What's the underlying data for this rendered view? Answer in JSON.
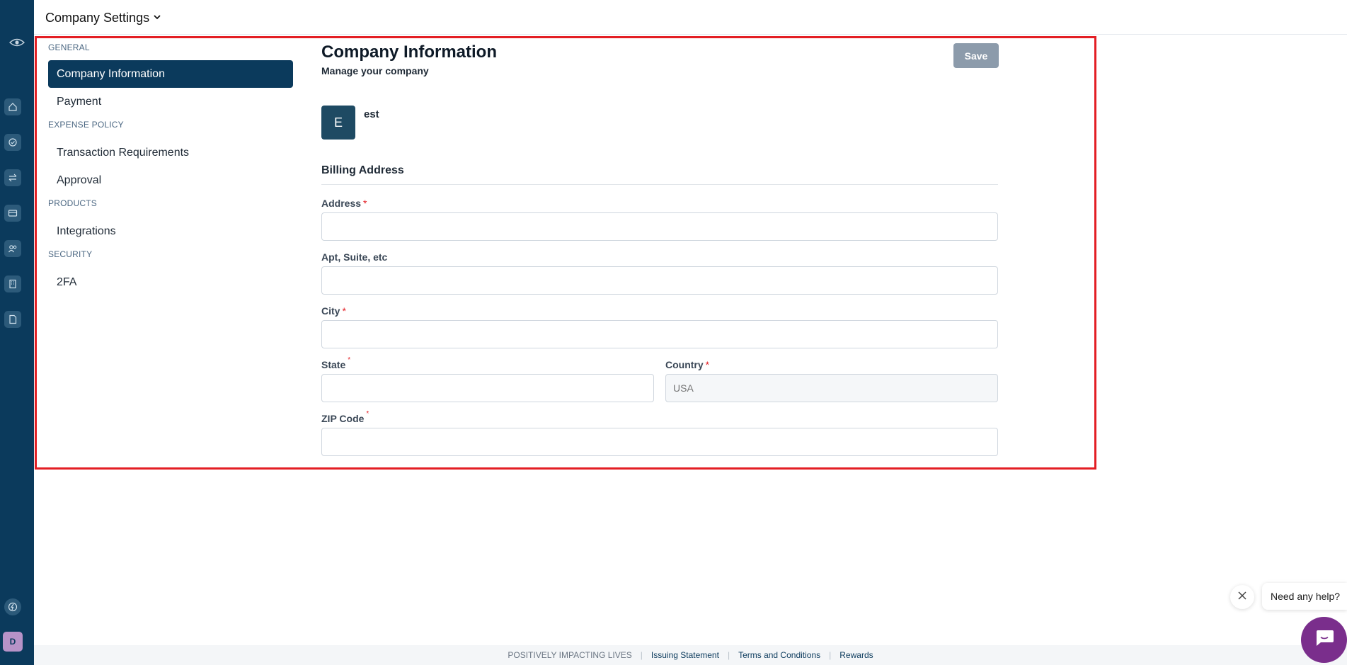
{
  "header": {
    "title": "Company Settings"
  },
  "rail": {
    "icons": [
      "eye-logo-icon",
      "home-icon",
      "check-circle-icon",
      "transfer-icon",
      "card-icon",
      "users-icon",
      "building-icon",
      "document-icon",
      "bolt-icon"
    ],
    "avatar_initial": "D"
  },
  "settings_nav": {
    "general": "GENERAL",
    "company_information": "Company Information",
    "payment": "Payment",
    "expense_policy": "EXPENSE POLICY",
    "transaction_requirements": "Transaction Requirements",
    "approval": "Approval",
    "products": "PRODUCTS",
    "integrations": "Integrations",
    "security": "SECURITY",
    "twofa": "2FA"
  },
  "main": {
    "title": "Company Information",
    "subtitle": "Manage your company",
    "save_label": "Save",
    "company_initial": "E",
    "company_name": "est",
    "billing_title": "Billing Address",
    "fields": {
      "address": {
        "label": "Address",
        "value": ""
      },
      "apt": {
        "label": "Apt, Suite, etc",
        "value": ""
      },
      "city": {
        "label": "City",
        "value": ""
      },
      "state": {
        "label": "State",
        "value": ""
      },
      "country": {
        "label": "Country",
        "value": "",
        "placeholder": "USA"
      },
      "zip": {
        "label": "ZIP Code",
        "value": ""
      }
    }
  },
  "footer": {
    "tagline": "POSITIVELY IMPACTING LIVES",
    "issuing": "Issuing Statement",
    "terms": "Terms and Conditions",
    "rewards": "Rewards"
  },
  "help": {
    "bubble_text": "Need any help?"
  },
  "colors": {
    "rail": "#0b3a5c",
    "highlight": "#e31e24",
    "chat": "#7a2e8c"
  }
}
